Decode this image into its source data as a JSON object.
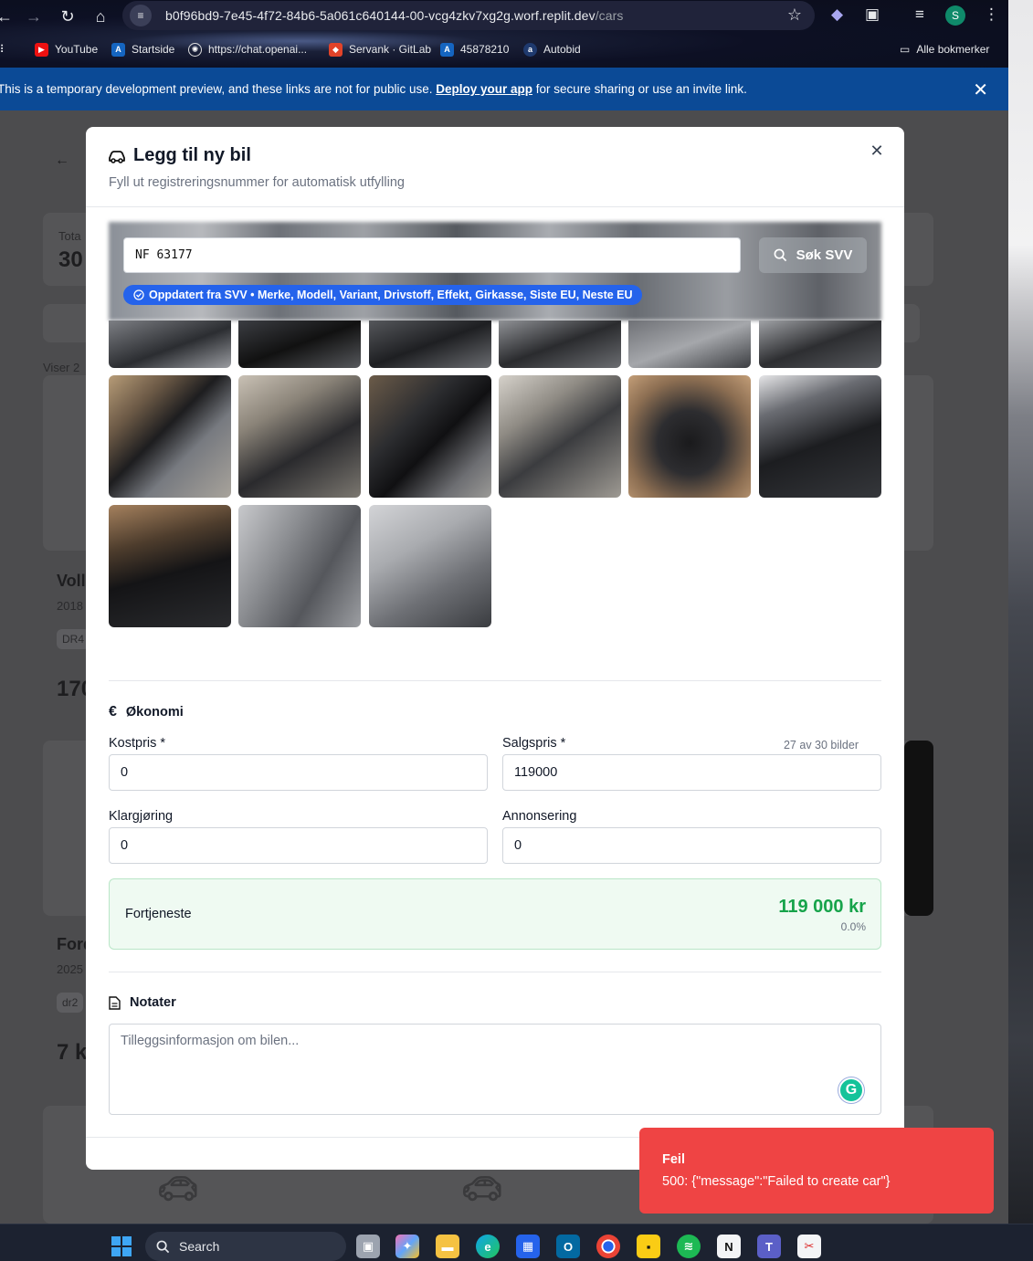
{
  "browser": {
    "url_host": "b0f96bd9-7e45-4f72-84b6-5a061c640144-00-vcg4zkv7xg2g.worf.replit.dev",
    "url_path": "/cars",
    "avatar_letter": "S",
    "bookmarks": [
      "YouTube",
      "Startside",
      "https://chat.openai...",
      "Servank · GitLab",
      "45878210",
      "Autobid"
    ],
    "all_bookmarks": "Alle bokmerker"
  },
  "banner": {
    "text_before": "This is a temporary development preview, and these links are not for public use.",
    "link": "Deploy your app",
    "text_after": "for secure sharing or use an invite link."
  },
  "background": {
    "total_label": "Tota",
    "total_value": "30",
    "showing": "Viser 2",
    "card1_title": "Voll",
    "card1_year": "2018",
    "card1_reg": "DR4",
    "card1_price": "170",
    "card2_title": "Ford",
    "card2_year": "2025",
    "card2_reg": "dr2",
    "card2_price": "7 k"
  },
  "modal": {
    "title": "Legg til ny bil",
    "subtitle": "Fyll ut registreringsnummer for automatisk utfylling",
    "search_value": "NF 63177",
    "search_button": "Søk SVV",
    "svv_badge": "Oppdatert fra SVV • Merke, Modell, Variant, Drivstoff, Effekt, Girkasse, Siste EU, Neste EU",
    "photo_count": "27 av 30 bilder",
    "economy": {
      "heading": "Økonomi",
      "kostpris_label": "Kostpris *",
      "kostpris_value": "0",
      "salgspris_label": "Salgspris *",
      "salgspris_value": "119000",
      "klargjoring_label": "Klargjøring",
      "klargjoring_value": "0",
      "annonsering_label": "Annonsering",
      "annonsering_value": "0"
    },
    "profit": {
      "label": "Fortjeneste",
      "value": "119 000 kr",
      "percent": "0.0%"
    },
    "notes": {
      "heading": "Notater",
      "placeholder": "Tilleggsinformasjon om bilen..."
    }
  },
  "toast": {
    "title": "Feil",
    "message": "500: {\"message\":\"Failed to create car\"}"
  },
  "taskbar": {
    "search": "Search"
  },
  "colors": {
    "accent_blue": "#2563eb",
    "success_green": "#16a34a",
    "error_red": "#ef4444",
    "banner_blue": "#0b4a96"
  }
}
